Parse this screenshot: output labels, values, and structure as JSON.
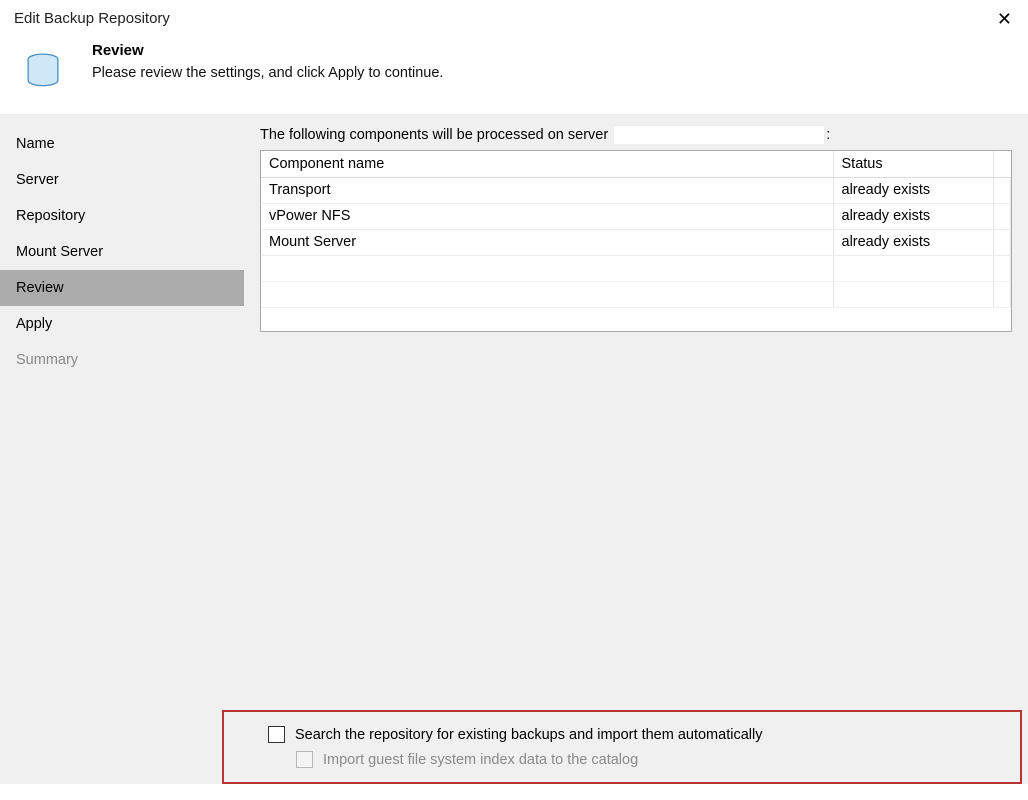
{
  "window": {
    "title": "Edit Backup Repository"
  },
  "header": {
    "title": "Review",
    "subtitle": "Please review the settings, and click Apply to continue."
  },
  "sidebar": {
    "items": [
      {
        "label": "Name"
      },
      {
        "label": "Server"
      },
      {
        "label": "Repository"
      },
      {
        "label": "Mount Server"
      },
      {
        "label": "Review"
      },
      {
        "label": "Apply"
      },
      {
        "label": "Summary"
      }
    ]
  },
  "content": {
    "intro_prefix": "The following components will be processed on server",
    "intro_server": "",
    "intro_suffix": ":",
    "table": {
      "columns": {
        "name": "Component name",
        "status": "Status"
      },
      "rows": [
        {
          "name": "Transport",
          "status": "already exists"
        },
        {
          "name": "vPower NFS",
          "status": "already exists"
        },
        {
          "name": "Mount Server",
          "status": "already exists"
        }
      ]
    },
    "options": {
      "search_label": "Search the repository for existing backups and import them automatically",
      "import_label": "Import guest file system index data to the catalog"
    }
  }
}
